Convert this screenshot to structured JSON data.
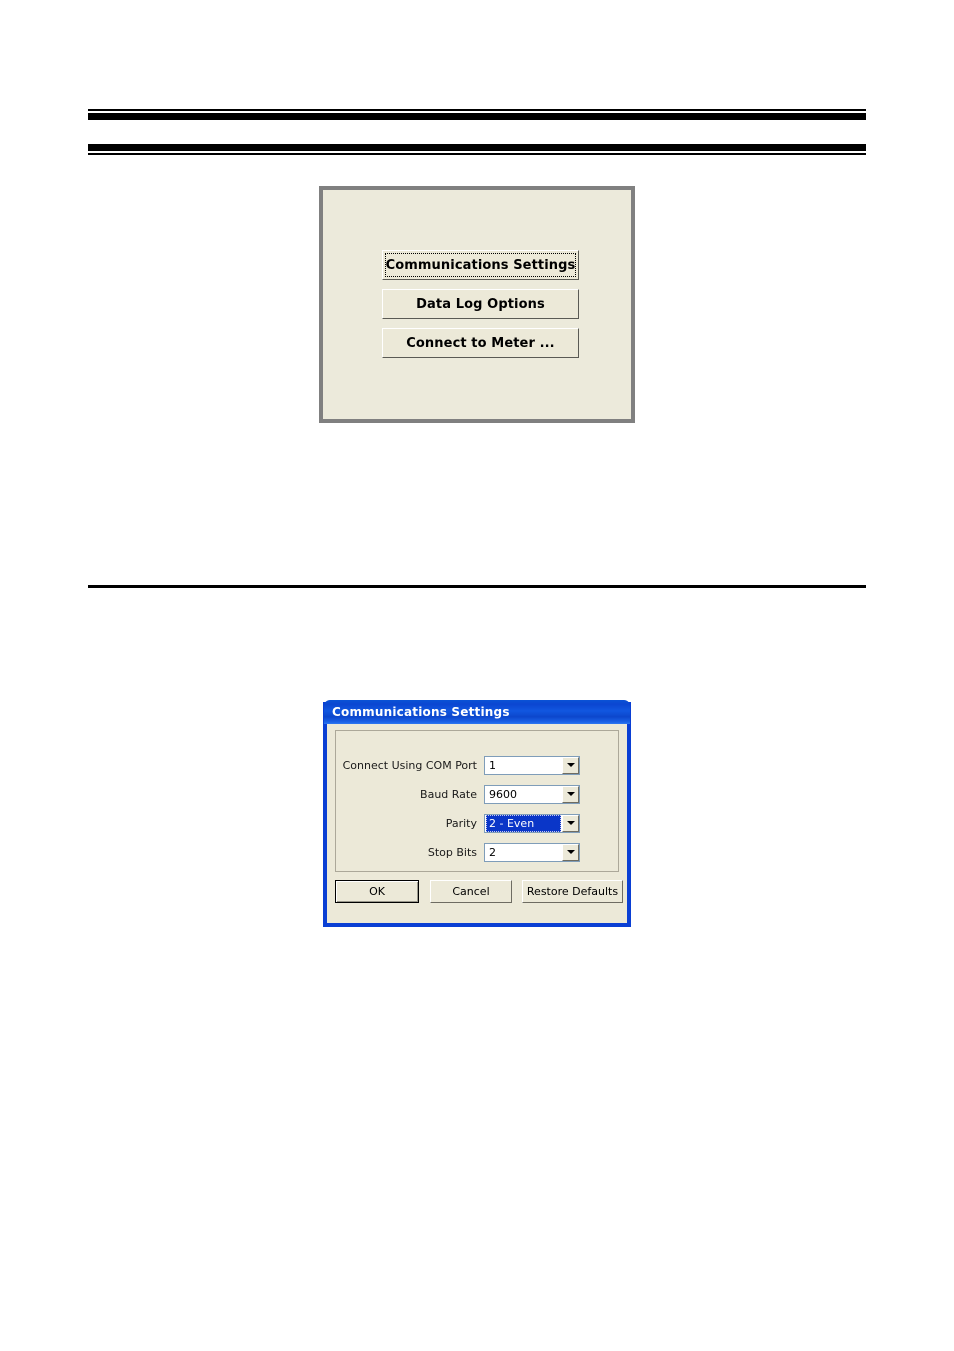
{
  "page": {
    "background": "#ffffff",
    "rules": {
      "top_label": "header-double-rule",
      "second_label": "header-double-rule-2",
      "middle_label": "section-divider-rule"
    }
  },
  "menu_dialog": {
    "name": "main-menu-panel",
    "background": "#eceadb",
    "border_color": "#808080",
    "buttons": [
      {
        "label": "Communications Settings",
        "focused": true
      },
      {
        "label": "Data Log Options",
        "focused": false
      },
      {
        "label": "Connect to Meter ...",
        "focused": false
      }
    ]
  },
  "comm_dialog": {
    "name": "communications-settings-dialog",
    "title": "Communications Settings",
    "title_bar_color": "#0b46d1",
    "face_color": "#ece9d8",
    "highlight_color": "#0a36c8",
    "fields": [
      {
        "label": "Connect Using COM Port",
        "value": "1",
        "selected": false
      },
      {
        "label": "Baud Rate",
        "value": "9600",
        "selected": false
      },
      {
        "label": "Parity",
        "value": "2 - Even",
        "selected": true
      },
      {
        "label": "Stop Bits",
        "value": "2",
        "selected": false
      }
    ],
    "buttons": [
      {
        "label": "OK",
        "default": true
      },
      {
        "label": "Cancel",
        "default": false
      },
      {
        "label": "Restore Defaults",
        "default": false
      }
    ]
  }
}
